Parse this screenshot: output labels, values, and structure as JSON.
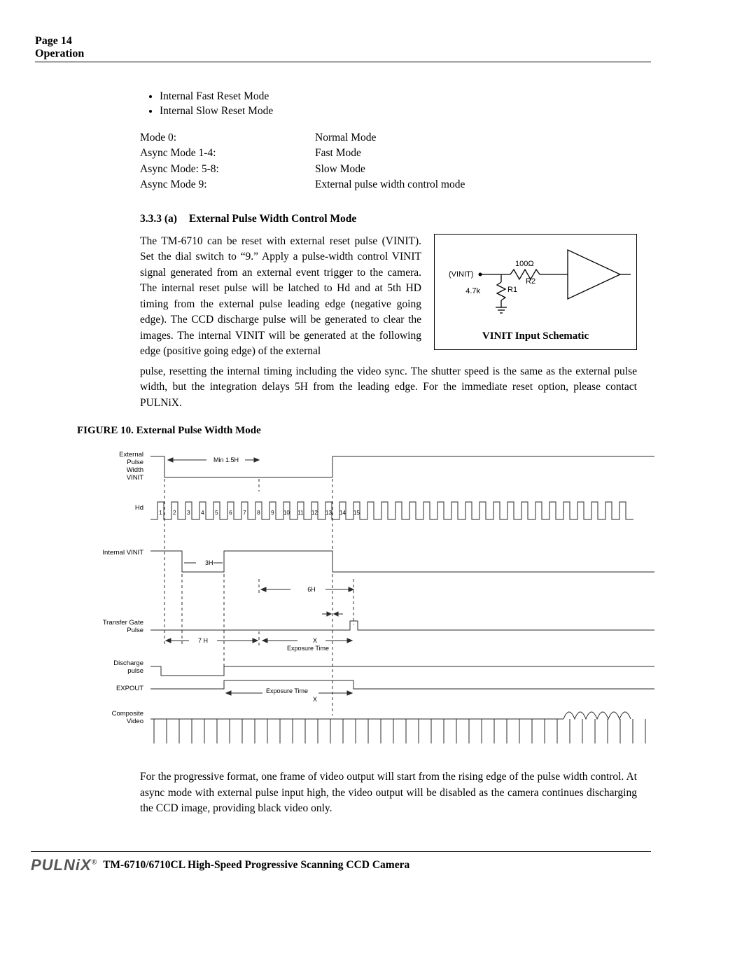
{
  "header": {
    "page_label": "Page 14",
    "section": "Operation"
  },
  "bullets": [
    "Internal Fast Reset Mode",
    "Internal Slow Reset Mode"
  ],
  "mode_table": [
    {
      "left": "Mode 0:",
      "right": "Normal Mode"
    },
    {
      "left": "Async Mode 1-4:",
      "right": "Fast Mode"
    },
    {
      "left": "Async Mode: 5-8:",
      "right": "Slow Mode"
    },
    {
      "left": "Async Mode 9:",
      "right": "External pulse width control mode"
    }
  ],
  "section": {
    "number": "3.3.3 (a)",
    "title": "External Pulse Width Control Mode",
    "para_left": "The TM-6710 can be reset with external reset pulse (VINIT). Set the dial switch to “9.” Apply a pulse-width control VINIT signal generated from an external event trigger to the camera. The internal reset pulse will be latched to Hd and at 5th HD timing from the external pulse leading edge (negative going edge). The CCD discharge pulse will be generated to clear the images. The internal VINIT will be generated at the following edge (positive going edge) of the external",
    "para_after": "pulse, resetting the internal timing including the video sync. The shutter speed is the same as the external pulse width, but the integration delays 5H from the leading edge. For the immediate reset option, please contact PULNiX."
  },
  "schematic": {
    "vinit_label": "(VINIT)",
    "r_100": "100Ω",
    "r2": "R2",
    "r_47k": "4.7k",
    "r1": "R1",
    "caption": "VINIT Input Schematic"
  },
  "figure_caption_bold": "FIGURE 10.",
  "figure_caption_rest": "External Pulse Width Mode",
  "timing": {
    "labels": {
      "ext_pulse": "External\nPulse\nWidth\nVINIT",
      "hd": "Hd",
      "int_vinit": "Internal VINIT",
      "transfer_gate": "Transfer Gate\nPulse",
      "discharge": "Discharge\npulse",
      "expout": "EXPOUT",
      "composite": "Composite\nVideo"
    },
    "anno": {
      "min15h": "Min 1.5H",
      "three_h": "3H",
      "six_h": "6H",
      "seven_h": "7 H",
      "x1": "X",
      "exposure_time1": "Exposure Time",
      "exposure_time2": "Exposure Time",
      "x2": "X"
    },
    "hd_numbers": [
      "1",
      "2",
      "3",
      "4",
      "5",
      "6",
      "7",
      "8",
      "9",
      "10",
      "11",
      "12",
      "13",
      "14",
      "15"
    ]
  },
  "bottom_para": "For the progressive format, one frame of video output will start from the rising edge of the pulse width control. At async mode with external pulse input high, the video output will be disabled as the camera continues discharging the CCD image, providing black video only.",
  "footer": {
    "logo": "PULNiX",
    "reg": "®",
    "text": "TM-6710/6710CL High-Speed Progressive Scanning CCD Camera"
  }
}
